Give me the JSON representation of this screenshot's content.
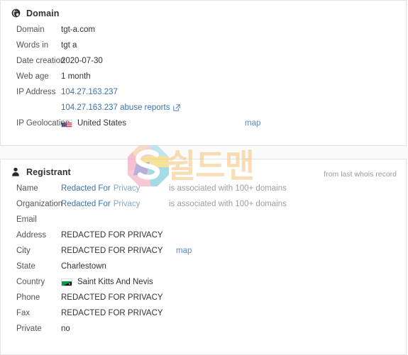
{
  "panels": [
    {
      "id": "domain",
      "icon": "globe-icon",
      "title": "Domain",
      "note": "",
      "rows": [
        {
          "label": "Domain",
          "value": "tgt-a.com",
          "kind": "text"
        },
        {
          "label": "Words in",
          "value": "tgt a",
          "kind": "text"
        },
        {
          "label": "Date creation",
          "value": "2020-07-30",
          "kind": "text"
        },
        {
          "label": "Web age",
          "value": "1 month",
          "kind": "text"
        },
        {
          "label": "IP Address",
          "value": "104.27.163.237",
          "kind": "link"
        },
        {
          "label": "",
          "value": "104.27.163.237 abuse reports",
          "kind": "link-ext"
        },
        {
          "label": "IP Geolocation",
          "value": "United States",
          "kind": "flag",
          "flag": "us",
          "extra_link": "map"
        }
      ]
    },
    {
      "id": "registrant",
      "icon": "user-icon",
      "title": "Registrant",
      "note": "from last whois record",
      "rows": [
        {
          "label": "Name",
          "value_link": "Redacted For",
          "value_soft": "Privacy",
          "kind": "split-link",
          "extra": "is associated with 100+ domains"
        },
        {
          "label": "Organization",
          "value_link": "Redacted For",
          "value_soft": "Privacy",
          "kind": "split-link",
          "extra": "is associated with 100+ domains"
        },
        {
          "label": "Email",
          "value": "",
          "kind": "text"
        },
        {
          "label": "Address",
          "value": "REDACTED FOR PRIVACY",
          "kind": "text"
        },
        {
          "label": "City",
          "value": "REDACTED FOR PRIVACY",
          "kind": "text",
          "extra_link": "map"
        },
        {
          "label": "State",
          "value": "Charlestown",
          "kind": "text"
        },
        {
          "label": "Country",
          "value": "Saint Kitts And Nevis",
          "kind": "flag",
          "flag": "kn"
        },
        {
          "label": "Phone",
          "value": "REDACTED FOR PRIVACY",
          "kind": "text"
        },
        {
          "label": "Fax",
          "value": "REDACTED FOR PRIVACY",
          "kind": "text"
        },
        {
          "label": "Private",
          "value": "no",
          "kind": "text"
        }
      ]
    }
  ],
  "watermark": {
    "logo_letter": "S",
    "text": "쉴드맨"
  },
  "colors": {
    "link": "#3b73af",
    "link_soft": "#8da7c4",
    "map_link": "#5b87c2",
    "muted": "#9e9e9e",
    "label": "#555555",
    "value": "#333333",
    "panel_border": "#e3e3e3",
    "watermark_text": "#f5c98a"
  }
}
